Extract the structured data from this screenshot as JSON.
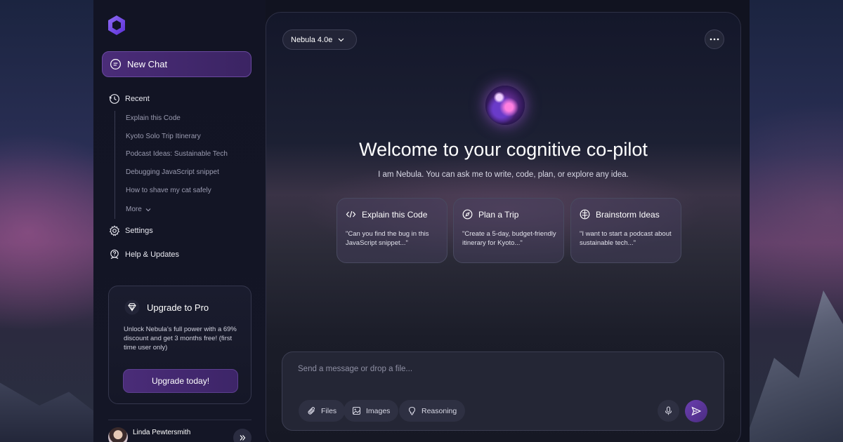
{
  "colors": {
    "accent": "#4a2c78",
    "accent_border": "#6a49a0",
    "sidebar_bg": "#121424",
    "text_muted": "#9a9bb0"
  },
  "sidebar": {
    "logo_icon": "hexagon-logo-icon",
    "new_chat_label": "New Chat",
    "recent_label": "Recent",
    "recent_items": [
      "Explain this Code",
      "Kyoto Solo Trip Itinerary",
      "Podcast Ideas: Sustainable Tech",
      "Debugging JavaScript snippet",
      "How to shave my cat safely"
    ],
    "more_label": "More",
    "settings_label": "Settings",
    "help_label": "Help & Updates",
    "upgrade": {
      "title": "Upgrade to Pro",
      "text": "Unlock Nebula’s full power with a 69% discount and get 3 months free! (first time user only)",
      "button_label": "Upgrade today!"
    },
    "user": {
      "name": "Linda Pewtersmith"
    }
  },
  "main": {
    "model_label": "Nebula 4.0e",
    "welcome_title": "Welcome to your cognitive co-pilot",
    "welcome_subtitle": "I am Nebula. You can ask me to write, code, plan, or explore any idea.",
    "cards": [
      {
        "title": "Explain this Code",
        "text": "\"Can you find the bug in this JavaScript snippet...\"",
        "icon": "code-icon"
      },
      {
        "title": "Plan a Trip",
        "text": "\"Create a 5-day, budget-friendly itinerary for Kyoto...\"",
        "icon": "compass-icon"
      },
      {
        "title": "Brainstorm Ideas",
        "text": "\"I want to start a podcast about sustainable tech...\"",
        "icon": "brain-icon"
      }
    ],
    "composer": {
      "placeholder": "Send a message or drop a file...",
      "files_label": "Files",
      "images_label": "Images",
      "reasoning_label": "Reasoning"
    }
  }
}
